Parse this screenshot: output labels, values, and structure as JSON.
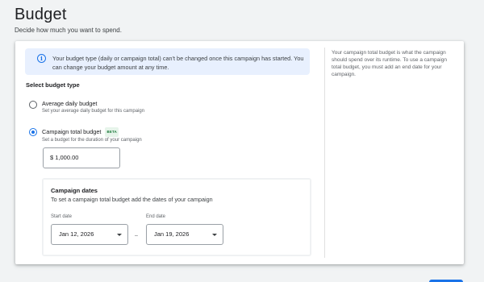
{
  "header": {
    "title": "Budget",
    "subtitle": "Decide how much you want to spend."
  },
  "info_banner": {
    "icon": "info-icon",
    "text": "Your budget type (daily or campaign total) can't be changed once this campaign has started. You can change your budget amount at any time."
  },
  "budget_type": {
    "label": "Select budget type",
    "options": [
      {
        "title": "Average daily budget",
        "description": "Set your average daily budget for this campaign",
        "selected": false
      },
      {
        "title": "Campaign total budget",
        "badge": "BETA",
        "description": "Set a budget for the duration of your campaign",
        "selected": true
      }
    ]
  },
  "amount": {
    "value": "$ 1,000.00"
  },
  "campaign_dates": {
    "title": "Campaign dates",
    "description": "To set a campaign total budget add the dates of your campaign",
    "start_label": "Start date",
    "start_value": "Jan 12, 2026",
    "separator": "–",
    "end_label": "End date",
    "end_value": "Jan 19, 2026"
  },
  "side_help": {
    "text": "Your campaign total budget is what the campaign should spend over its runtime. To use a campaign total budget, you must add an end date for your campaign."
  },
  "colors": {
    "accent": "#1a73e8",
    "banner_bg": "#e8f0fe",
    "beta_text": "#137333",
    "beta_bg": "#e6f4ea"
  }
}
